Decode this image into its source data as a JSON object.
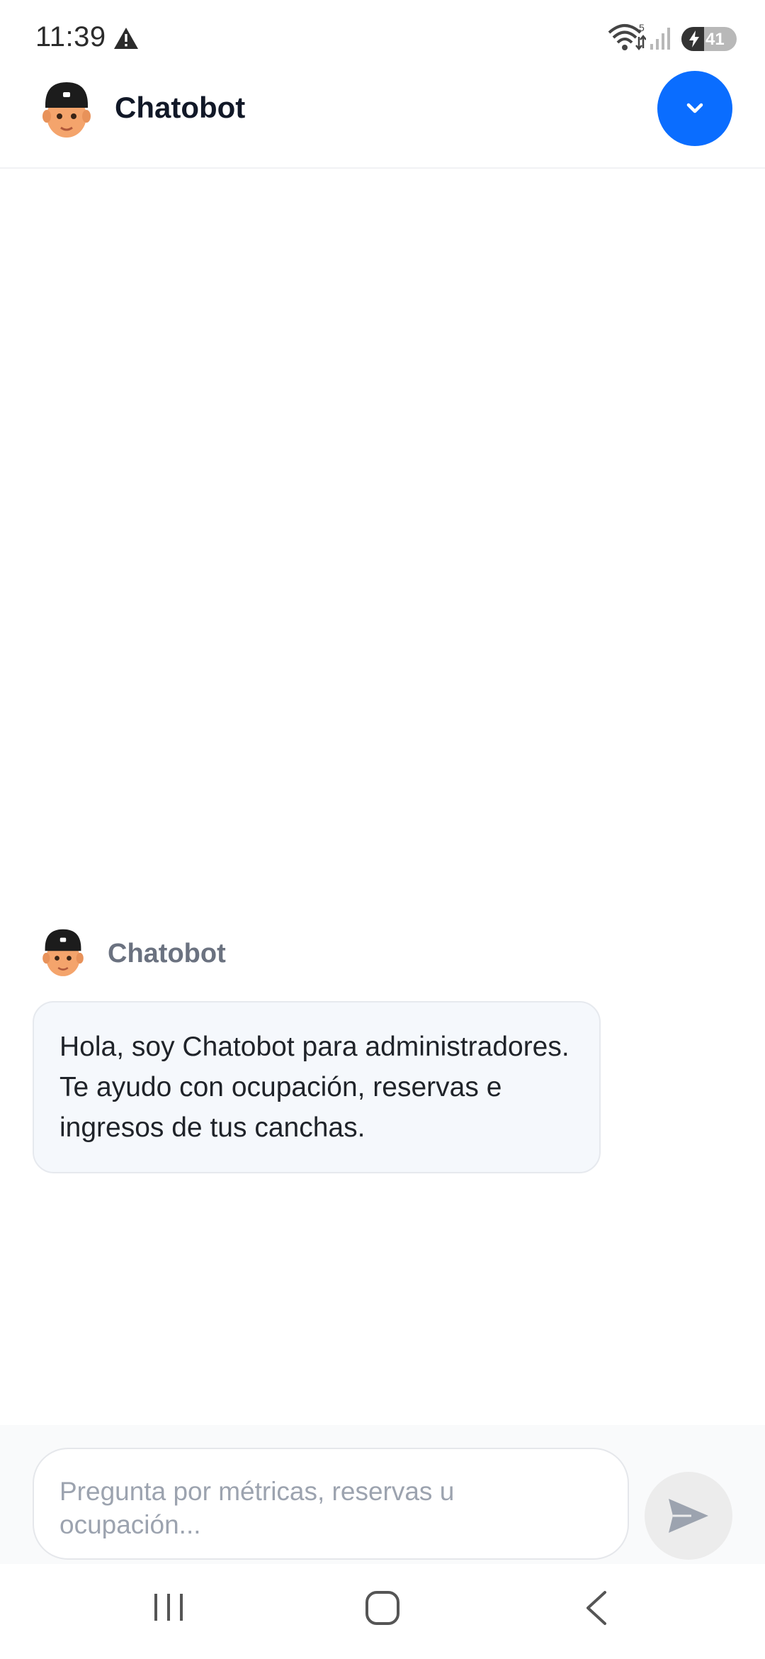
{
  "status_bar": {
    "time": "11:39",
    "warning_icon": "warning-triangle-icon",
    "wifi_icon": "wifi-icon",
    "wifi_badge": "5",
    "signal_icon": "cell-signal-icon",
    "battery_level": "41",
    "battery_fraction": 0.41
  },
  "header": {
    "title": "Chatobot",
    "avatar_icon": "bot-avatar-icon",
    "collapse_icon": "chevron-down-icon",
    "accent_color": "#0a6dff"
  },
  "messages": [
    {
      "sender": "Chatobot",
      "text": "Hola, soy Chatobot para administradores. Te ayudo con ocupación, reservas e ingresos de tus canchas."
    }
  ],
  "composer": {
    "placeholder": "Pregunta por métricas, reservas u ocupación...",
    "value": "",
    "send_icon": "send-icon"
  },
  "nav_bar": {
    "recents_icon": "recents-icon",
    "home_icon": "home-icon",
    "back_icon": "back-icon"
  }
}
